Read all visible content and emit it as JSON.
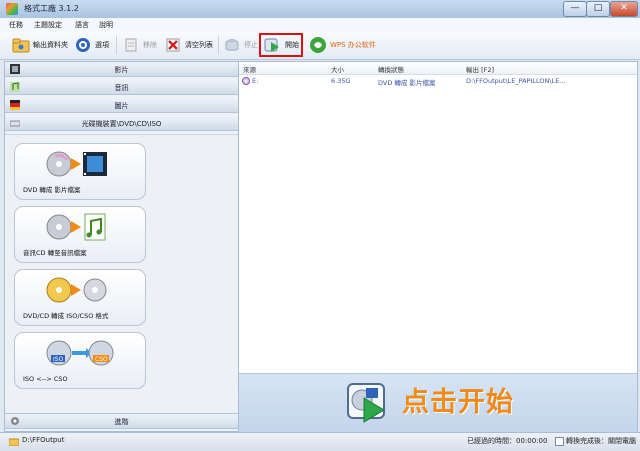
{
  "window": {
    "title": "格式工廠 3.1.2",
    "controls": {
      "minimize": "—",
      "maximize": "□",
      "close": "✕"
    }
  },
  "menu": [
    "任務",
    "主題設定",
    "語言",
    "說明"
  ],
  "toolbar": {
    "output_folder": "輸出資料夾",
    "options": "選項",
    "remove": "移除",
    "clear_list": "清空列表",
    "stop": "停止",
    "start": "開始",
    "wps": "WPS 办公软件"
  },
  "categories": {
    "video": "影片",
    "audio": "音訊",
    "image": "圖片",
    "rom": "光碟機裝置\\DVD\\CD\\ISO",
    "advanced": "進階"
  },
  "rom_actions": [
    "DVD 轉成 影片檔案",
    "音訊CD 轉至音訊檔案",
    "DVD/CD 轉成 ISO/CSO 格式",
    "ISO <--> CSO"
  ],
  "task_list": {
    "columns": [
      "來源",
      "大小",
      "轉換狀態",
      "輸出 [F2]"
    ],
    "rows": [
      {
        "source": "E:",
        "size": "6.35G",
        "status": "DVD 轉成 影片檔案",
        "output": "D:\\FFOutput\\LE_PAPILLON\\LE..."
      }
    ]
  },
  "promo": {
    "text": "点击开始"
  },
  "status": {
    "output_path": "D:\\FFOutput",
    "elapsed": "已經過的時間：00:00:00",
    "after_convert": "轉換完成後：關閉電腦"
  },
  "colors": {
    "highlight": "#e01010",
    "promo": "#f08a18",
    "link": "#3b55a8"
  }
}
